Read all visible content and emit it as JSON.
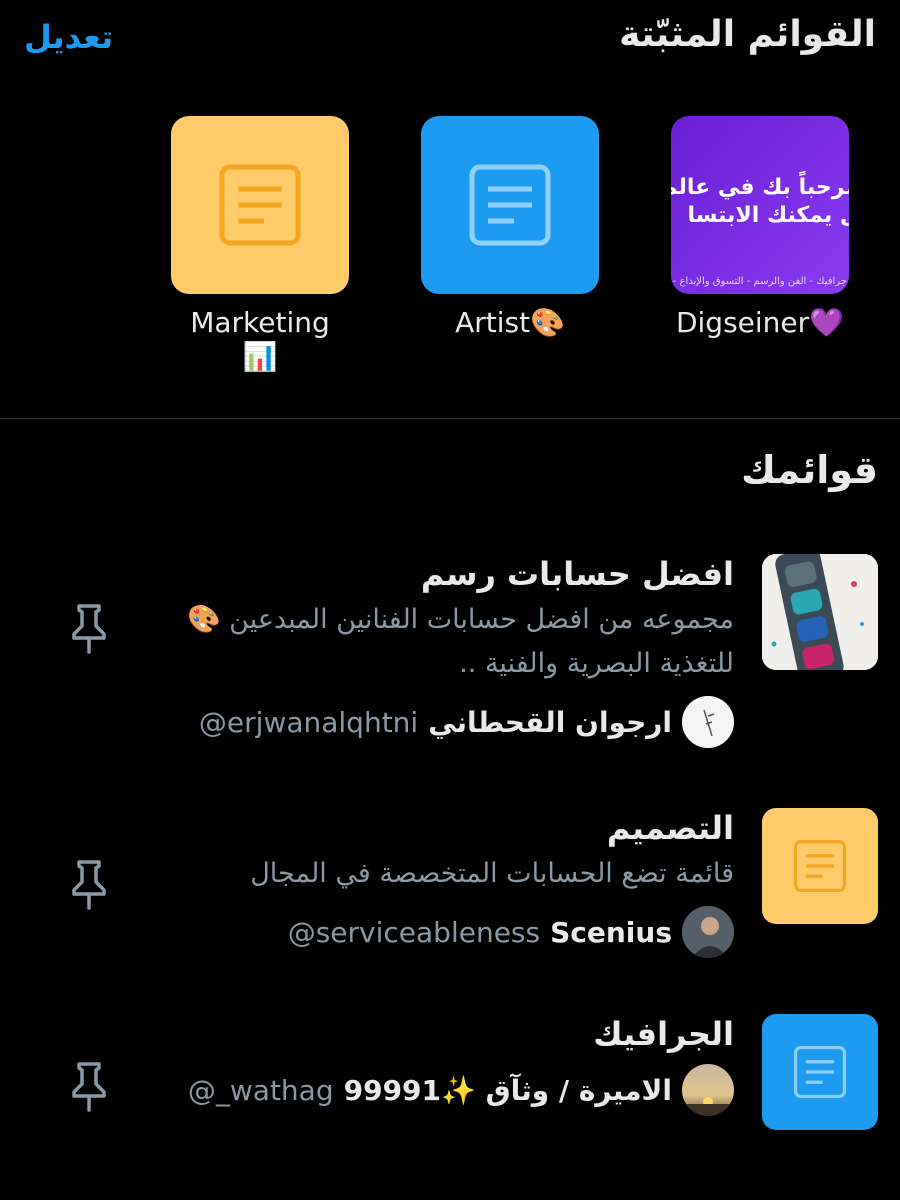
{
  "header": {
    "title": "القوائم المثبّتة",
    "edit_label": "تعديل"
  },
  "pinned": [
    {
      "label": "Digseiner💜",
      "thumb_kind": "image",
      "thumb_text_line1": "مرحباً بك في عالم",
      "thumb_text_line2": "ل يمكنك الابتسا",
      "thumb_text_line3": "جرافيك - الفن والرسم - التسوق والإبداع - الكتابة",
      "color": "#7b2fe0"
    },
    {
      "label": "Artist🎨",
      "thumb_kind": "doc",
      "color": "#1d9bf0"
    },
    {
      "label": "Marketing 📊",
      "thumb_kind": "doc",
      "color": "#ffcb6b"
    }
  ],
  "your_lists_title": "قوائمك",
  "lists": [
    {
      "name": "افضل حسابات رسم",
      "description": "مجموعه من افضل حسابات الفنانين المبدعين 🎨 للتغذية البصرية والفنية ..",
      "owner_name": "ارجوان القحطاني",
      "owner_handle": "@erjwanalqhtni",
      "thumb_kind": "paint",
      "pin_icon": "pin-icon"
    },
    {
      "name": "التصميم",
      "description": "قائمة تضع الحسابات المتخصصة في المجال",
      "owner_name": "Scenius",
      "owner_handle": "@serviceableness",
      "thumb_kind": "doc",
      "color": "#ffcb6b",
      "pin_icon": "pin-icon"
    },
    {
      "name": "الجرافيك",
      "description": "",
      "owner_name": "الاميرة / وثآق ✨99991",
      "owner_handle": "@_wathag",
      "thumb_kind": "doc",
      "color": "#1d9bf0",
      "pin_icon": "pin-icon"
    }
  ]
}
